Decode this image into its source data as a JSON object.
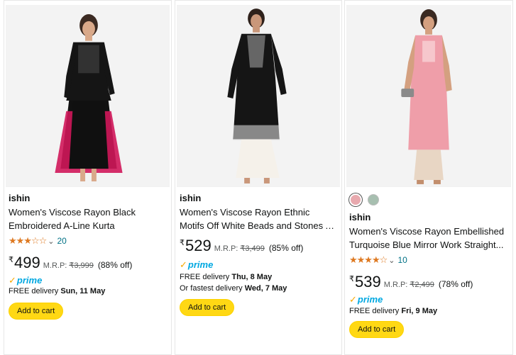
{
  "products": [
    {
      "brand": "ishin",
      "title": "Women's Viscose Rayon Black Embroidered A-Line Kurta",
      "rating_stars": "★★★☆☆",
      "rating_count": "20",
      "currency": "₹",
      "price": "499",
      "mrp_label": "M.R.P:",
      "mrp": "₹3,999",
      "discount": "(88% off)",
      "prime": "prime",
      "delivery_prefix": "FREE delivery ",
      "delivery_date": "Sun, 11 May",
      "add_to_cart": "Add to cart"
    },
    {
      "brand": "ishin",
      "title": "Women's Viscose Rayon Ethnic Motifs Off White Beads and Stones A-Line...",
      "currency": "₹",
      "price": "529",
      "mrp_label": "M.R.P:",
      "mrp": "₹3,499",
      "discount": "(85% off)",
      "prime": "prime",
      "delivery_prefix": "FREE delivery ",
      "delivery_date": "Thu, 8 May",
      "fastest_prefix": "Or fastest delivery ",
      "fastest_date": "Wed, 7 May",
      "add_to_cart": "Add to cart"
    },
    {
      "swatches": [
        "#e8a9ae",
        "#a7bfb0"
      ],
      "brand": "ishin",
      "title": "Women's Viscose Rayon Embellished Turquoise Blue Mirror Work Straight...",
      "rating_stars": "★★★★☆",
      "rating_count": "10",
      "currency": "₹",
      "price": "539",
      "mrp_label": "M.R.P:",
      "mrp": "₹2,499",
      "discount": "(78% off)",
      "prime": "prime",
      "delivery_prefix": "FREE delivery ",
      "delivery_date": "Fri, 9 May",
      "add_to_cart": "Add to cart"
    }
  ],
  "colors": {
    "accent_button": "#ffd814",
    "star": "#de7921",
    "link": "#007185",
    "prime": "#00a8e1"
  }
}
